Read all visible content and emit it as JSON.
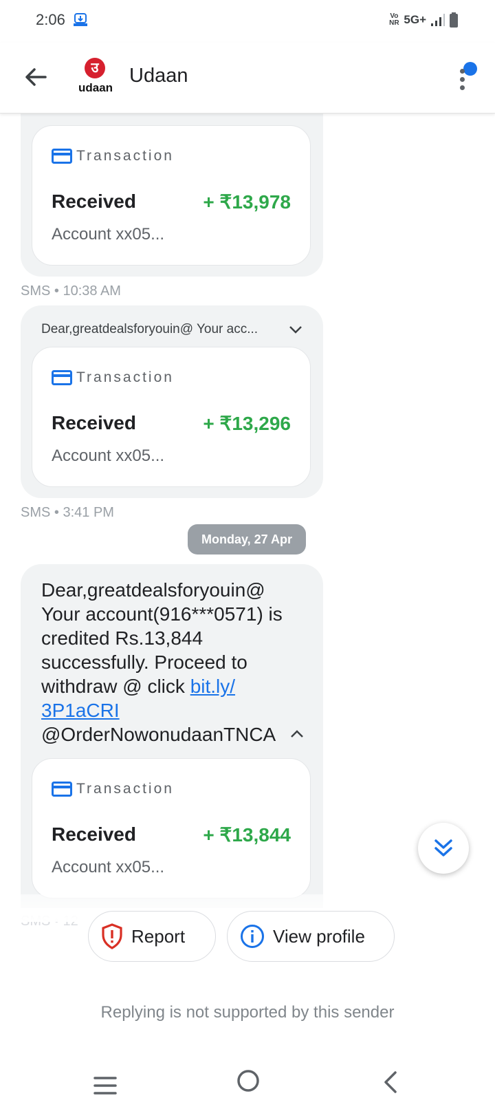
{
  "status_bar": {
    "time": "2:06",
    "volte": "Vo NR",
    "network": "5G+"
  },
  "header": {
    "logo_text": "udaan",
    "logo_glyph": "उ",
    "title": "Udaan"
  },
  "messages": [
    {
      "card": {
        "label": "Transaction",
        "type": "Received",
        "amount": "+ ₹13,978",
        "account": "Account xx05..."
      },
      "meta": "SMS • 10:38 AM"
    },
    {
      "preview": "Dear,greatdealsforyouin@ Your acc...",
      "card": {
        "label": "Transaction",
        "type": "Received",
        "amount": "+ ₹13,296",
        "account": "Account xx05..."
      },
      "meta": "SMS • 3:41 PM"
    },
    {
      "text_before_link": "Dear,greatdealsforyouin@ Your account(916***0571) is credited Rs.13,844 successfully. Proceed to withdraw @ click ",
      "link": "bit.ly/ 3P1aCRI",
      "text_after_link": " @OrderNowonudaanTNCA",
      "card": {
        "label": "Transaction",
        "type": "Received",
        "amount": "+ ₹13,844",
        "account": "Account xx05..."
      },
      "meta": "SMS • 12"
    }
  ],
  "date_chip": "Monday, 27 Apr",
  "actions": {
    "report": "Report",
    "view_profile": "View profile"
  },
  "footer": {
    "no_reply": "Replying is not supported by this sender"
  },
  "colors": {
    "accent": "#1a73e8",
    "amount_green": "#2ea84a",
    "report_red": "#d93025",
    "bubble_bg": "#f1f3f4"
  }
}
